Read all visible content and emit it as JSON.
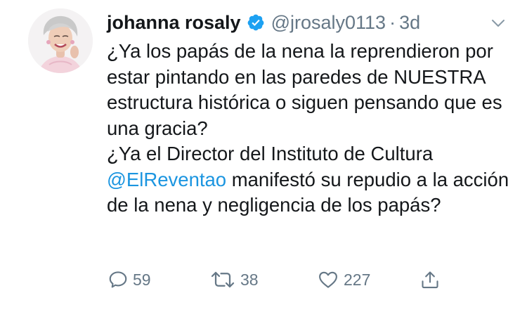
{
  "tweet": {
    "author_name": "johanna rosaly",
    "handle": "@jrosaly0113",
    "separator": "·",
    "time": "3d",
    "text": {
      "para1": "¿Ya los papás de la nena la reprendieron por estar pintando en las paredes de NUESTRA estructura histórica o siguen pensando que es una gracia?",
      "para2_before": "¿Ya el Director del Instituto de Cultura ",
      "mention": "@ElReventao",
      "para2_after": " manifestó su repudio a la acción de la nena y negligencia de los papás?"
    },
    "actions": {
      "reply_icon": "reply-icon",
      "replies": "59",
      "retweet_icon": "retweet-icon",
      "retweets": "38",
      "like_icon": "heart-icon",
      "likes": "227",
      "share_icon": "share-icon"
    },
    "colors": {
      "text": "#14171a",
      "secondary": "#657786",
      "link": "#1b95e0",
      "verified": "#1da1f2"
    }
  }
}
